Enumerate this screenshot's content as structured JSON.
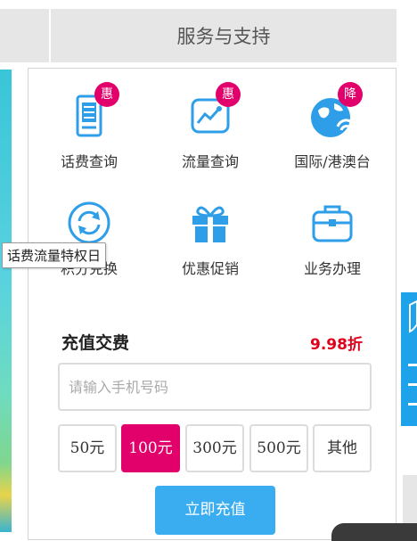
{
  "header": {
    "title": "服务与支持"
  },
  "services": [
    {
      "label": "话费查询",
      "badge": "惠",
      "icon": "phone-bill-icon"
    },
    {
      "label": "流量查询",
      "badge": "惠",
      "icon": "data-chart-icon"
    },
    {
      "label": "国际/港澳台",
      "badge": "降",
      "icon": "globe-wifi-icon"
    },
    {
      "label": "积分兑换",
      "badge": "",
      "icon": "refresh-exchange-icon"
    },
    {
      "label": "优惠促销",
      "badge": "",
      "icon": "gift-icon"
    },
    {
      "label": "业务办理",
      "badge": "",
      "icon": "briefcase-icon"
    }
  ],
  "tooltip": "话费流量特权日",
  "recharge": {
    "title": "充值交费",
    "discount": "9.98折",
    "phone_placeholder": "请输入手机号码",
    "amounts": [
      "50元",
      "100元",
      "300元",
      "500元",
      "其他"
    ],
    "selected_amount": "100元",
    "submit_label": "立即充值"
  },
  "colors": {
    "accent": "#3aadf0",
    "badge": "#e2006a",
    "discount": "#e0001b"
  }
}
